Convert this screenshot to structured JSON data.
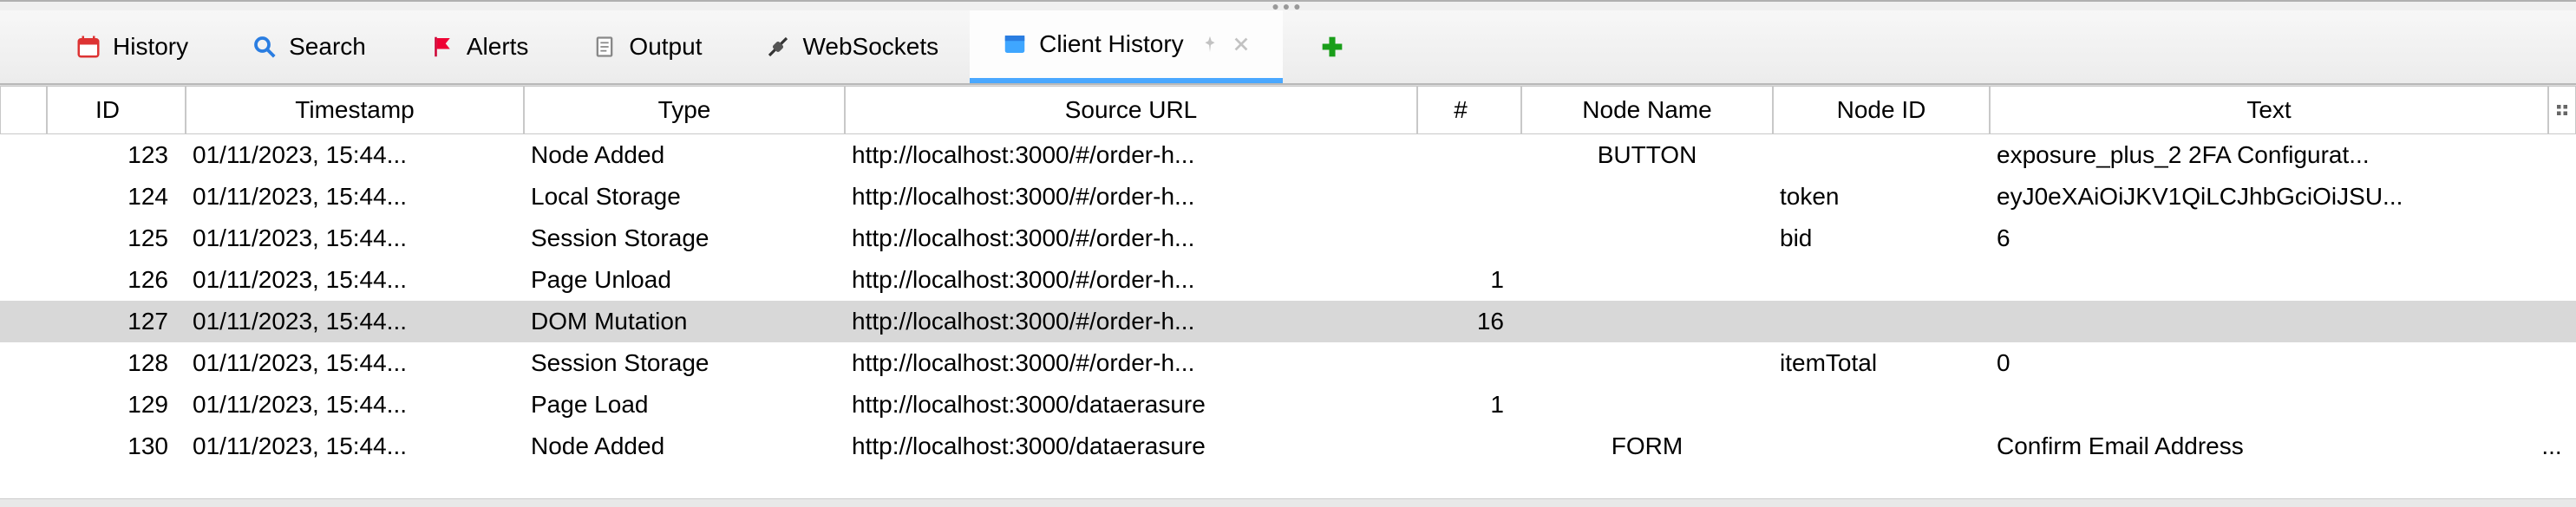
{
  "tabs": {
    "history": "History",
    "search": "Search",
    "alerts": "Alerts",
    "output": "Output",
    "websockets": "WebSockets",
    "client_history": "Client History"
  },
  "columns": {
    "id": "ID",
    "timestamp": "Timestamp",
    "type": "Type",
    "source_url": "Source URL",
    "count": "#",
    "node_name": "Node Name",
    "node_id": "Node ID",
    "text": "Text"
  },
  "rows": [
    {
      "id": "123",
      "ts": "01/11/2023, 15:44...",
      "type": "Node Added",
      "url": "http://localhost:3000/#/order-h...",
      "count": "",
      "node_name": "BUTTON",
      "node_id": "",
      "text": "exposure_plus_2 2FA Configurat...",
      "last": ""
    },
    {
      "id": "124",
      "ts": "01/11/2023, 15:44...",
      "type": "Local Storage",
      "url": "http://localhost:3000/#/order-h...",
      "count": "",
      "node_name": "",
      "node_id": "token",
      "text": "eyJ0eXAiOiJKV1QiLCJhbGciOiJSU...",
      "last": ""
    },
    {
      "id": "125",
      "ts": "01/11/2023, 15:44...",
      "type": "Session Storage",
      "url": "http://localhost:3000/#/order-h...",
      "count": "",
      "node_name": "",
      "node_id": "bid",
      "text": "6",
      "last": ""
    },
    {
      "id": "126",
      "ts": "01/11/2023, 15:44...",
      "type": "Page Unload",
      "url": "http://localhost:3000/#/order-h...",
      "count": "1",
      "node_name": "",
      "node_id": "",
      "text": "",
      "last": ""
    },
    {
      "id": "127",
      "ts": "01/11/2023, 15:44...",
      "type": "DOM Mutation",
      "url": "http://localhost:3000/#/order-h...",
      "count": "16",
      "node_name": "",
      "node_id": "",
      "text": "",
      "last": "",
      "selected": true
    },
    {
      "id": "128",
      "ts": "01/11/2023, 15:44...",
      "type": "Session Storage",
      "url": "http://localhost:3000/#/order-h...",
      "count": "",
      "node_name": "",
      "node_id": "itemTotal",
      "text": "0",
      "last": ""
    },
    {
      "id": "129",
      "ts": "01/11/2023, 15:44...",
      "type": "Page Load",
      "url": "http://localhost:3000/dataerasure",
      "count": "1",
      "node_name": "",
      "node_id": "",
      "text": "",
      "last": ""
    },
    {
      "id": "130",
      "ts": "01/11/2023, 15:44...",
      "type": "Node Added",
      "url": "http://localhost:3000/dataerasure",
      "count": "",
      "node_name": "FORM",
      "node_id": "",
      "text": "Confirm Email Address",
      "last": "..."
    }
  ]
}
